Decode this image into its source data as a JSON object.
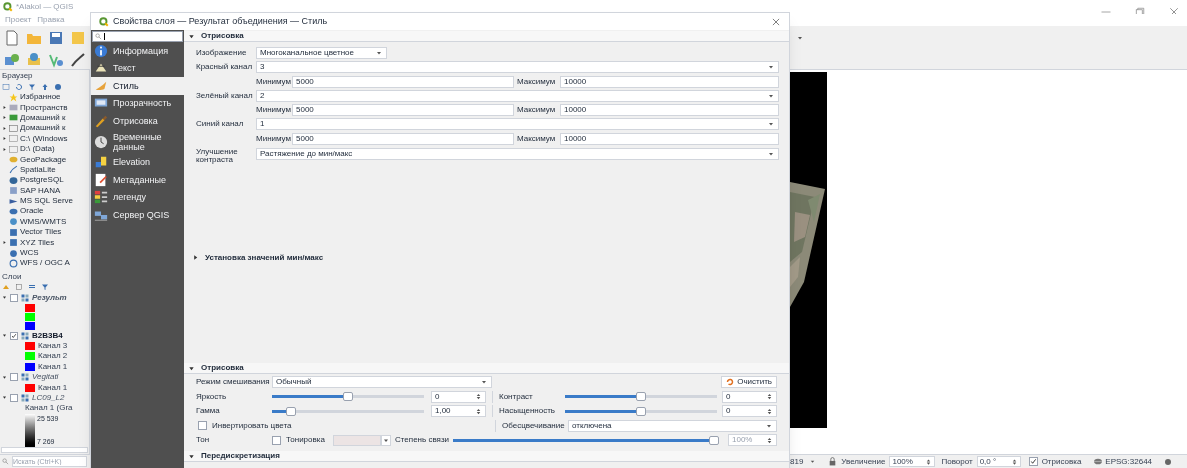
{
  "main_window": {
    "title": "*Alakol — QGIS",
    "menu": [
      "Проект",
      "Правка"
    ]
  },
  "browser": {
    "title": "Браузер",
    "items": [
      {
        "label": "Избранное",
        "kind": "leaf"
      },
      {
        "label": "Пространств",
        "kind": "branch"
      },
      {
        "label": "Домашний к",
        "kind": "branch"
      },
      {
        "label": "Домашний к",
        "kind": "branch"
      },
      {
        "label": "C:\\ (Windows",
        "kind": "branch"
      },
      {
        "label": "D:\\ (Data)",
        "kind": "branch"
      },
      {
        "label": "GeoPackage",
        "kind": "leaf"
      },
      {
        "label": "SpatiaLite",
        "kind": "leaf"
      },
      {
        "label": "PostgreSQL",
        "kind": "leaf"
      },
      {
        "label": "SAP HANA",
        "kind": "leaf"
      },
      {
        "label": "MS SQL Serve",
        "kind": "leaf"
      },
      {
        "label": "Oracle",
        "kind": "leaf"
      },
      {
        "label": "WMS/WMTS",
        "kind": "leaf"
      },
      {
        "label": "Vector Tiles",
        "kind": "leaf"
      },
      {
        "label": "XYZ Tiles",
        "kind": "branch"
      },
      {
        "label": "WCS",
        "kind": "leaf"
      },
      {
        "label": "WFS / OGC A",
        "kind": "leaf"
      }
    ]
  },
  "layers_panel": {
    "title": "Слои",
    "layers": [
      {
        "name": "Результ",
        "checked": false,
        "expanded": true,
        "bold": true,
        "italic": true,
        "legend": [
          {
            "kind": "swatch",
            "color": "#ff0000"
          },
          {
            "kind": "swatch",
            "color": "#00ff00"
          },
          {
            "kind": "swatch",
            "color": "#0000ff"
          }
        ]
      },
      {
        "name": "B2B3B4",
        "checked": true,
        "expanded": true,
        "bold": true,
        "italic": false,
        "legend": [
          {
            "kind": "swatch",
            "color": "#ff0000",
            "label": "Канал 3"
          },
          {
            "kind": "swatch",
            "color": "#00ff00",
            "label": "Канал 2"
          },
          {
            "kind": "swatch",
            "color": "#0000ff",
            "label": "Канал 1"
          }
        ]
      },
      {
        "name": "Vegitati",
        "checked": false,
        "expanded": true,
        "bold": false,
        "italic": true,
        "legend": [
          {
            "kind": "swatch",
            "color": "#ff0000",
            "label": "Канал 1"
          }
        ]
      },
      {
        "name": "LC09_L2",
        "checked": false,
        "expanded": true,
        "bold": false,
        "italic": true,
        "legend": [
          {
            "kind": "text",
            "label": "Канал 1 (Gra"
          },
          {
            "kind": "gradient",
            "max": "25 539",
            "min": "7 269"
          }
        ]
      }
    ],
    "search": {
      "placeholder": "Искать (Ctrl+K)"
    }
  },
  "status_bar": {
    "coordinate": "819",
    "magnifier_label": "Увеличение",
    "magnifier": "100%",
    "rotation_label": "Поворот",
    "rotation": "0,0 °",
    "render": {
      "label": "Отрисовка",
      "checked": true
    },
    "crs": "EPSG:32644"
  },
  "dialog": {
    "title": "Свойства слоя — Результат объединения — Стиль",
    "nav": [
      {
        "label": "Информация",
        "selected": false
      },
      {
        "label": "Текст",
        "selected": false
      },
      {
        "label": "Стиль",
        "selected": true
      },
      {
        "label": "Прозрачность",
        "selected": false
      },
      {
        "label": "Отрисовка",
        "selected": false
      },
      {
        "label": "Временные данные",
        "selected": false
      },
      {
        "label": "Elevation",
        "selected": false
      },
      {
        "label": "Метаданные",
        "selected": false
      },
      {
        "label": "легенду",
        "selected": false
      },
      {
        "label": "Сервер QGIS",
        "selected": false
      }
    ],
    "band_rendering": {
      "title": "Отрисовка",
      "expanded": true,
      "render_type": {
        "label": "Изображение",
        "value": "Многоканальное цветное"
      },
      "bands": [
        {
          "label": "Красный канал",
          "band": "3",
          "min_label": "Минимум",
          "min": "5000",
          "max_label": "Максимум",
          "max": "10000"
        },
        {
          "label": "Зелёный канал",
          "band": "2",
          "min_label": "Минимум",
          "min": "5000",
          "max_label": "Максимум",
          "max": "10000"
        },
        {
          "label": "Синий канал",
          "band": "1",
          "min_label": "Минимум",
          "min": "5000",
          "max_label": "Максимум",
          "max": "10000"
        }
      ],
      "contrast": {
        "label": "Улучшение контраста",
        "value": "Растяжение до мин/макс"
      },
      "minmax": {
        "title": "Установка значений мин/макс",
        "expanded": false
      }
    },
    "color_rendering": {
      "title": "Отрисовка",
      "expanded": true,
      "blend": {
        "label": "Режим смешивания",
        "value": "Обычный"
      },
      "reset": "Очистить",
      "brightness": {
        "label": "Яркость",
        "value": "0",
        "level": 0.5
      },
      "contrast": {
        "label": "Контраст",
        "value": "0",
        "level": 0.5
      },
      "gamma": {
        "label": "Гамма",
        "value": "1,00",
        "level": 0.1
      },
      "saturation": {
        "label": "Насыщенность",
        "value": "0",
        "level": 0.5
      },
      "invert": {
        "label": "Инвертировать цвета",
        "checked": false
      },
      "grayscale": {
        "label": "Обесцвечивание",
        "value": "отключена"
      },
      "hue": {
        "label": "Тон",
        "colorize": {
          "label": "Тонировка",
          "checked": false
        },
        "strength": {
          "label": "Степень связи",
          "value": "100%",
          "level": 1
        }
      }
    },
    "resampling": {
      "title": "Передискретизация",
      "expanded": true
    }
  }
}
